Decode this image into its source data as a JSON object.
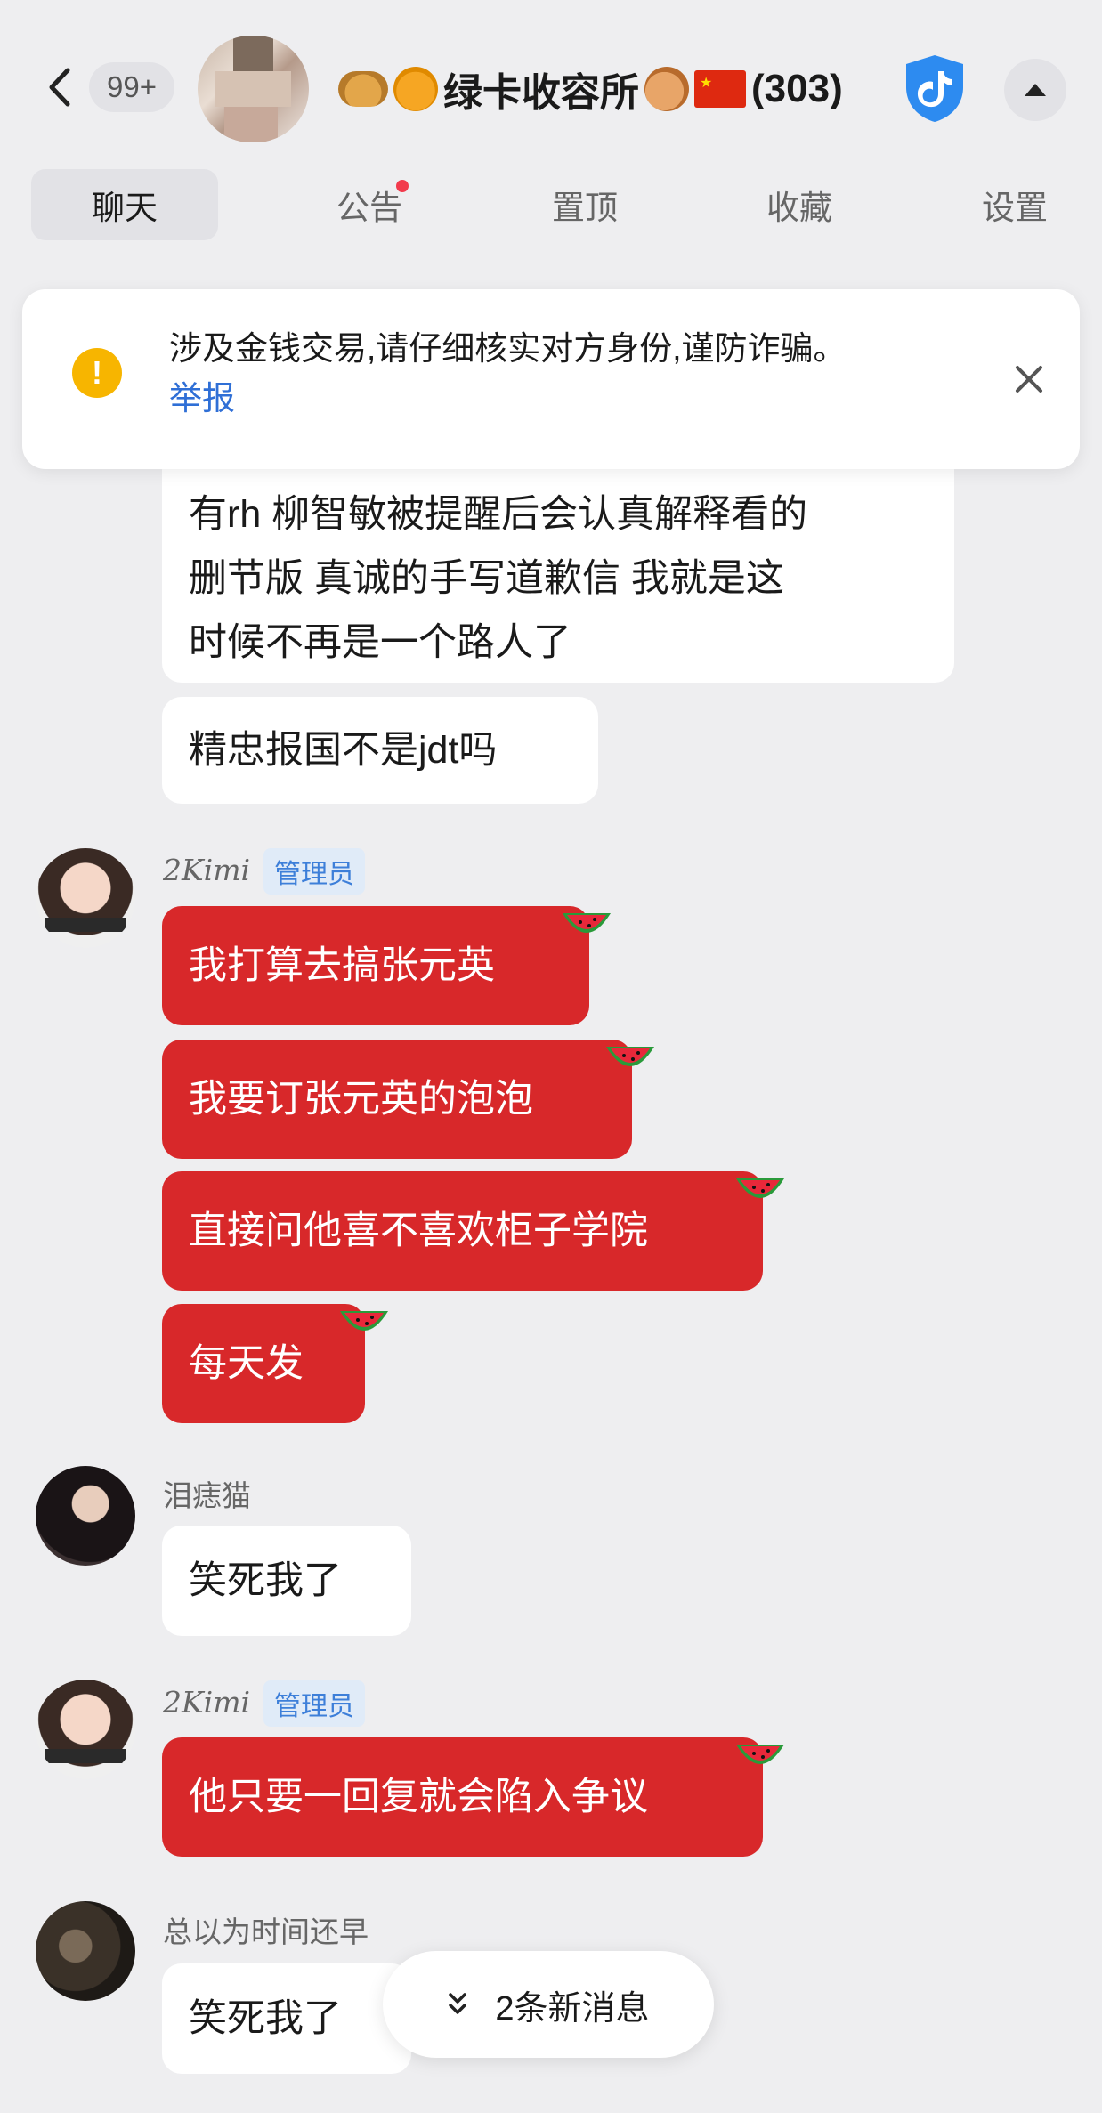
{
  "header": {
    "unread_badge": "99+",
    "group_title": "绿卡收容所",
    "member_count": "(303)",
    "icons": [
      "chevron-left-icon",
      "leopard-emoji",
      "tiger-emoji",
      "onion-emoji",
      "china-flag-emoji",
      "verified-shield-icon",
      "caret-up-icon"
    ]
  },
  "tabs": [
    {
      "label": "聊天",
      "active": true
    },
    {
      "label": "公告",
      "active": false,
      "has_dot": true
    },
    {
      "label": "置顶",
      "active": false
    },
    {
      "label": "收藏",
      "active": false
    },
    {
      "label": "设置",
      "active": false
    }
  ],
  "warning": {
    "text": "涉及金钱交易,请仔细核实对方身份,谨防诈骗。",
    "link": "举报",
    "icon": "warning-icon",
    "close_icon": "close-icon"
  },
  "messages": [
    {
      "text_lines": [
        "有rh 柳智敏被提醒后会认真解释看的",
        "删节版 真诚的手写道歉信 我就是这",
        "时候不再是一个路人了"
      ],
      "style": "white"
    },
    {
      "text": "精忠报国不是jdt吗",
      "style": "white"
    },
    {
      "sender": "2Kimi",
      "role": "管理员",
      "avatar": "kimi-avatar"
    },
    {
      "text": "我打算去搞张元英",
      "style": "red"
    },
    {
      "text": "我要订张元英的泡泡",
      "style": "red"
    },
    {
      "text": "直接问他喜不喜欢柜子学院",
      "style": "red"
    },
    {
      "text": "每天发",
      "style": "red"
    },
    {
      "sender": "泪痣猫",
      "avatar": "cat-avatar"
    },
    {
      "text": "笑死我了",
      "style": "white"
    },
    {
      "sender": "2Kimi",
      "role": "管理员",
      "avatar": "kimi-avatar"
    },
    {
      "text": "他只要一回复就会陷入争议",
      "style": "red"
    },
    {
      "sender": "总以为时间还早",
      "avatar": "time-avatar"
    },
    {
      "text": "笑死我了",
      "style": "white"
    }
  ],
  "new_messages": {
    "label": "2条新消息",
    "icon": "double-chevron-down-icon"
  },
  "colors": {
    "background": "#eeeef0",
    "red_bubble": "#d8282a",
    "link": "#2f6fd6",
    "warning": "#f7b500",
    "dot": "#f23a4c"
  }
}
